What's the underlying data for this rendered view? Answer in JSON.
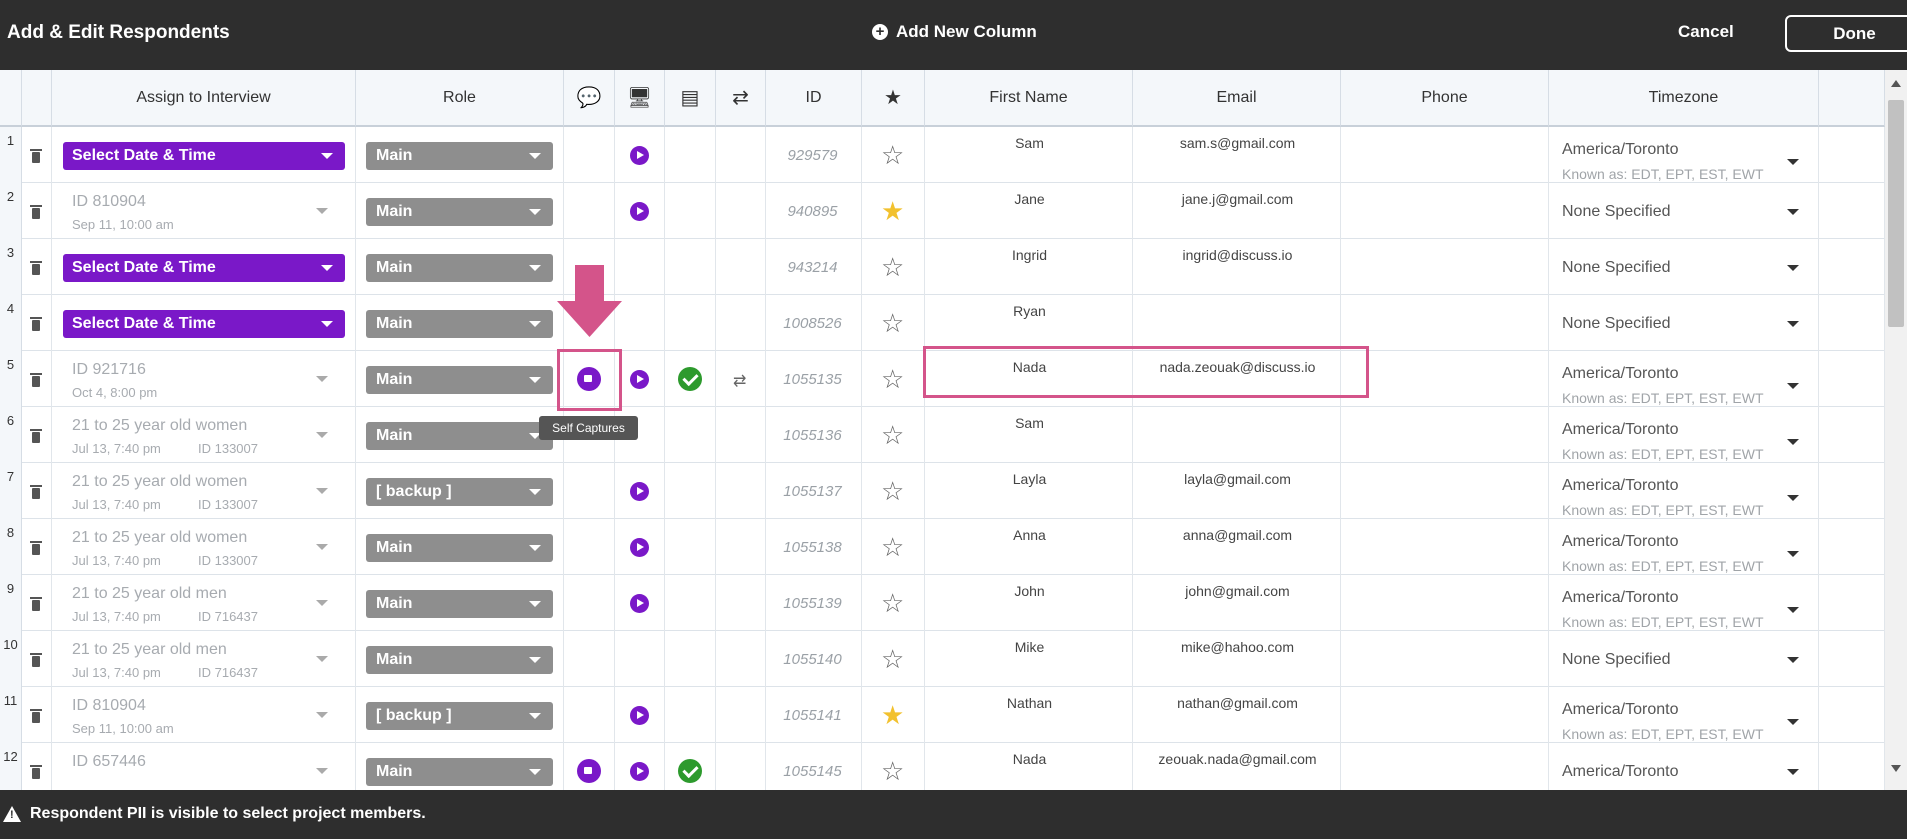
{
  "header": {
    "title": "Add & Edit Respondents",
    "add_column": "Add New Column",
    "cancel": "Cancel",
    "done": "Done"
  },
  "columns": {
    "assign": "Assign to Interview",
    "role": "Role",
    "self_capture_icon": "chat-video-icon",
    "device_check_icon": "monitor-check-icon",
    "screener_icon": "document-check-icon",
    "swap_icon": "swap-arrows-icon",
    "id": "ID",
    "star_icon": "star-icon",
    "first_name": "First Name",
    "email": "Email",
    "phone": "Phone",
    "timezone": "Timezone"
  },
  "rows": [
    {
      "num": "1",
      "assign": "Select Date & Time",
      "assign_sub": "",
      "assign_sub2": "",
      "assign_type": "select",
      "role": "Main",
      "self_capture": false,
      "device": true,
      "screener": false,
      "swap": false,
      "id": "929579",
      "starred": false,
      "first_name": "Sam",
      "email": "sam.s@gmail.com",
      "tz": "America/Toronto",
      "tz_sub": "Known as: EDT, EPT, EST, EWT"
    },
    {
      "num": "2",
      "assign": "ID 810904",
      "assign_sub": "Sep 11, 10:00 am",
      "assign_sub2": "",
      "assign_type": "text",
      "role": "Main",
      "self_capture": false,
      "device": true,
      "screener": false,
      "swap": false,
      "id": "940895",
      "starred": true,
      "first_name": "Jane",
      "email": "jane.j@gmail.com",
      "tz": "None Specified",
      "tz_sub": ""
    },
    {
      "num": "3",
      "assign": "Select Date & Time",
      "assign_sub": "",
      "assign_sub2": "",
      "assign_type": "select",
      "role": "Main",
      "self_capture": false,
      "device": false,
      "screener": false,
      "swap": false,
      "id": "943214",
      "starred": false,
      "first_name": "Ingrid",
      "email": "ingrid@discuss.io",
      "tz": "None Specified",
      "tz_sub": ""
    },
    {
      "num": "4",
      "assign": "Select Date & Time",
      "assign_sub": "",
      "assign_sub2": "",
      "assign_type": "select",
      "role": "Main",
      "self_capture": false,
      "device": false,
      "screener": false,
      "swap": false,
      "id": "1008526",
      "starred": false,
      "first_name": "Ryan",
      "email": "",
      "tz": "None Specified",
      "tz_sub": ""
    },
    {
      "num": "5",
      "assign": "ID 921716",
      "assign_sub": "Oct 4, 8:00 pm",
      "assign_sub2": "",
      "assign_type": "text",
      "role": "Main",
      "self_capture": true,
      "device": true,
      "screener": true,
      "swap": true,
      "id": "1055135",
      "starred": false,
      "first_name": "Nada",
      "email": "nada.zeouak@discuss.io",
      "tz": "America/Toronto",
      "tz_sub": "Known as: EDT, EPT, EST, EWT"
    },
    {
      "num": "6",
      "assign": "21 to 25 year old women",
      "assign_sub": "Jul 13, 7:40 pm",
      "assign_sub2": "ID 133007",
      "assign_type": "text",
      "role": "Main",
      "self_capture": false,
      "device": false,
      "screener": false,
      "swap": false,
      "id": "1055136",
      "starred": false,
      "first_name": "Sam",
      "email": "",
      "tz": "America/Toronto",
      "tz_sub": "Known as: EDT, EPT, EST, EWT"
    },
    {
      "num": "7",
      "assign": "21 to 25 year old women",
      "assign_sub": "Jul 13, 7:40 pm",
      "assign_sub2": "ID 133007",
      "assign_type": "text",
      "role": "[ backup ]",
      "self_capture": false,
      "device": true,
      "screener": false,
      "swap": false,
      "id": "1055137",
      "starred": false,
      "first_name": "Layla",
      "email": "layla@gmail.com",
      "tz": "America/Toronto",
      "tz_sub": "Known as: EDT, EPT, EST, EWT"
    },
    {
      "num": "8",
      "assign": "21 to 25 year old women",
      "assign_sub": "Jul 13, 7:40 pm",
      "assign_sub2": "ID 133007",
      "assign_type": "text",
      "role": "Main",
      "self_capture": false,
      "device": true,
      "screener": false,
      "swap": false,
      "id": "1055138",
      "starred": false,
      "first_name": "Anna",
      "email": "anna@gmail.com",
      "tz": "America/Toronto",
      "tz_sub": "Known as: EDT, EPT, EST, EWT"
    },
    {
      "num": "9",
      "assign": "21 to 25 year old men",
      "assign_sub": "Jul 13, 7:40 pm",
      "assign_sub2": "ID 716437",
      "assign_type": "text",
      "role": "Main",
      "self_capture": false,
      "device": true,
      "screener": false,
      "swap": false,
      "id": "1055139",
      "starred": false,
      "first_name": "John",
      "email": "john@gmail.com",
      "tz": "America/Toronto",
      "tz_sub": "Known as: EDT, EPT, EST, EWT"
    },
    {
      "num": "10",
      "assign": "21 to 25 year old men",
      "assign_sub": "Jul 13, 7:40 pm",
      "assign_sub2": "ID 716437",
      "assign_type": "text",
      "role": "Main",
      "self_capture": false,
      "device": false,
      "screener": false,
      "swap": false,
      "id": "1055140",
      "starred": false,
      "first_name": "Mike",
      "email": "mike@hahoo.com",
      "tz": "None Specified",
      "tz_sub": ""
    },
    {
      "num": "11",
      "assign": "ID 810904",
      "assign_sub": "Sep 11, 10:00 am",
      "assign_sub2": "",
      "assign_type": "text",
      "role": "[ backup ]",
      "self_capture": false,
      "device": true,
      "screener": false,
      "swap": false,
      "id": "1055141",
      "starred": true,
      "first_name": "Nathan",
      "email": "nathan@gmail.com",
      "tz": "America/Toronto",
      "tz_sub": "Known as: EDT, EPT, EST, EWT"
    },
    {
      "num": "12",
      "assign": "ID 657446",
      "assign_sub": "",
      "assign_sub2": "",
      "assign_type": "text",
      "role": "Main",
      "self_capture": true,
      "device": true,
      "screener": true,
      "swap": false,
      "id": "1055145",
      "starred": false,
      "first_name": "Nada",
      "email": "zeouak.nada@gmail.com",
      "tz": "America/Toronto",
      "tz_sub": ""
    }
  ],
  "tooltip": "Self Captures",
  "footer": {
    "text": "Respondent PII is visible to select project members."
  },
  "colors": {
    "accent_purple": "#7a18c8",
    "highlight_pink": "#d4548a",
    "star_gold": "#f2c12e",
    "check_green": "#2d9a2d"
  }
}
